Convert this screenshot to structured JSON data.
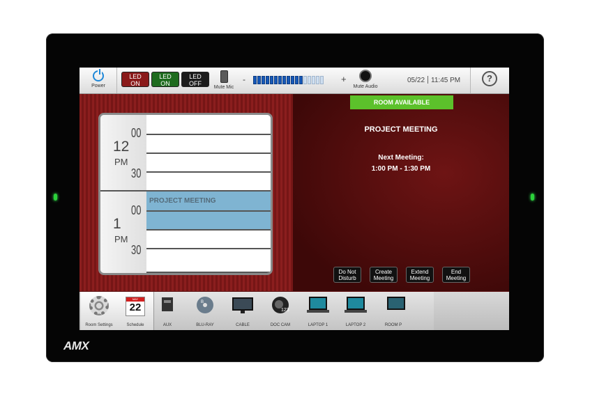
{
  "brand": "AMX",
  "topbar": {
    "power_label": "Power",
    "led_buttons": [
      {
        "line1": "LED",
        "line2": "ON",
        "color": "#8a1a1a"
      },
      {
        "line1": "LED",
        "line2": "ON",
        "color": "#1e6b1e"
      },
      {
        "line1": "LED",
        "line2": "OFF",
        "color": "#1c1c1c"
      }
    ],
    "mute_mic_label": "Mute Mic",
    "volume_minus": "-",
    "volume_plus": "+",
    "volume_level_fraction": 0.7,
    "volume_segments": 17,
    "mute_audio_label": "Mute Audio",
    "date": "05/22",
    "time": "11:45 PM",
    "help_icon": "?"
  },
  "status": {
    "room_available": "ROOM AVAILABLE",
    "current_meeting": "PROJECT MEETING",
    "next_label": "Next Meeting:",
    "next_time": "1:00 PM - 1:30 PM",
    "accent": "#5cc12b"
  },
  "actions": [
    {
      "line1": "Do Not",
      "line2": "Disturb"
    },
    {
      "line1": "Create",
      "line2": "Meeting"
    },
    {
      "line1": "Extend",
      "line2": "Meeting"
    },
    {
      "line1": "End",
      "line2": "Meeting"
    }
  ],
  "schedule": {
    "hours": [
      {
        "hour": "12",
        "ampm": "PM",
        "m00": "00",
        "m30": "30"
      },
      {
        "hour": "1",
        "ampm": "PM",
        "m00": "00",
        "m30": "30"
      }
    ],
    "meeting_label": "PROJECT MEETING"
  },
  "dock": {
    "room_settings": "Room Settings",
    "schedule": "Schedule",
    "calendar_month": "MAY",
    "calendar_day": "22",
    "sources": [
      "AUX",
      "BLU-RAY",
      "CABLE",
      "DOC CAM",
      "LAPTOP 1",
      "LAPTOP 2",
      "ROOM P"
    ]
  }
}
